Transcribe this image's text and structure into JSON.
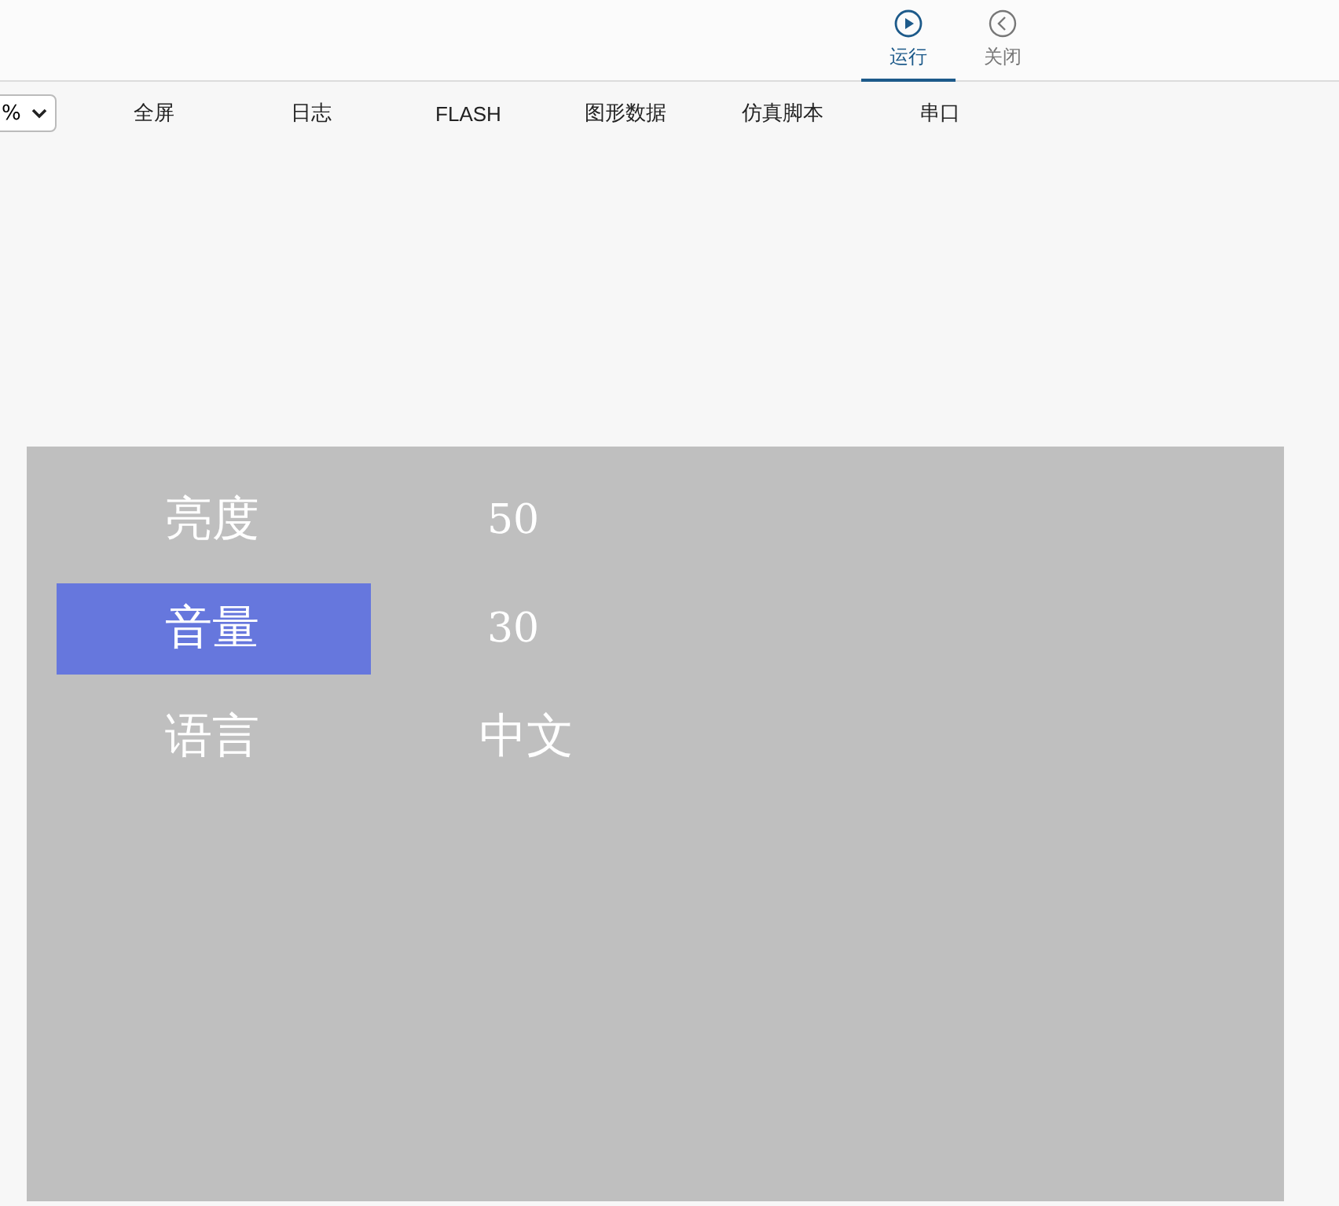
{
  "top_buttons": [
    {
      "kind": "play",
      "label": "运行",
      "selected": true
    },
    {
      "kind": "back",
      "label": "关闭",
      "selected": false
    }
  ],
  "toolbar": {
    "zoom_select": {
      "value": "%"
    },
    "items": [
      "全屏",
      "日志",
      "FLASH",
      "图形数据",
      "仿真脚本",
      "串口"
    ]
  },
  "screen": {
    "menu": [
      {
        "kind": "number",
        "label": "亮度",
        "value": "50",
        "selected": false
      },
      {
        "kind": "number",
        "label": "音量",
        "value": "30",
        "selected": true
      },
      {
        "kind": "text",
        "label": "语言",
        "value": "中文",
        "selected": false
      }
    ]
  }
}
